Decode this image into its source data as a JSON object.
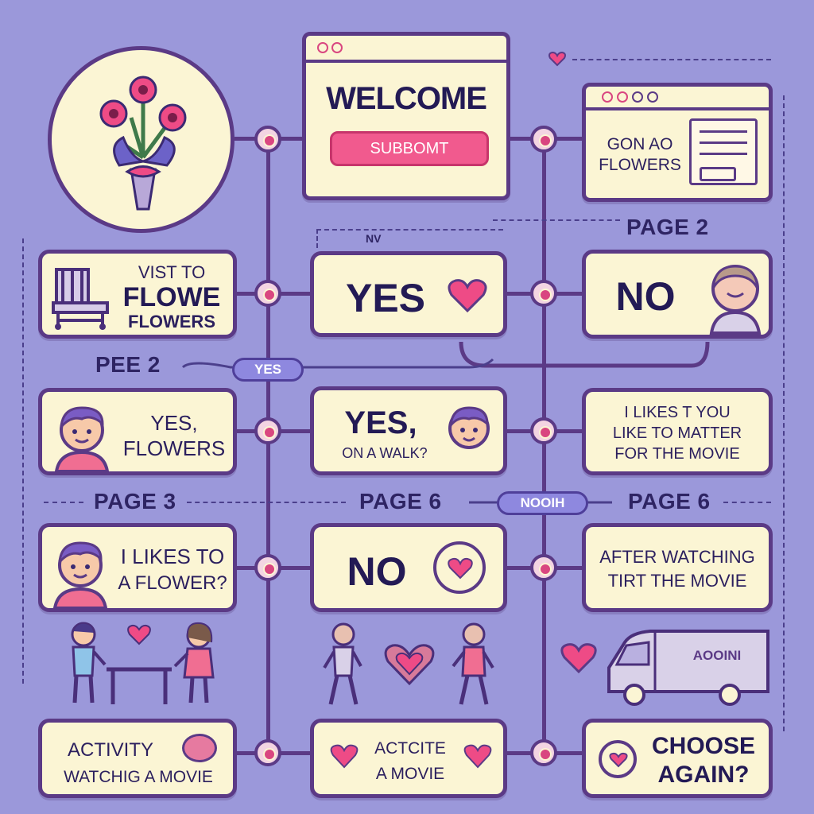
{
  "welcome_window": {
    "title": "WELCOME",
    "button_label": "SUBBOMT"
  },
  "flower_window": {
    "line1": "GON AO",
    "line2": "FLOWERS"
  },
  "labels": {
    "page2_top": "PAGE 2",
    "nav_caption": "NV",
    "pee2": "PEE 2",
    "yes_pill": "YES",
    "page3": "PAGE 3",
    "page6_mid": "PAGE 6",
    "nooh_pill": "NOOIH",
    "page6_right": "PAGE 6"
  },
  "rows": [
    {
      "left": {
        "line1": "VIST TO",
        "line2": "FLOWE",
        "line3": "FLOWERS"
      },
      "center": {
        "line1": "YES"
      },
      "right": {
        "line1": "NO"
      }
    },
    {
      "left": {
        "line1": "YES,",
        "line2": "FLOWERS"
      },
      "center": {
        "line1": "YES,",
        "line2": "ON A WALK?"
      },
      "right": {
        "line1": "I LIKES T YOU",
        "line2": "LIKE TO MATTER",
        "line3": "FOR THE MOVIE"
      }
    },
    {
      "left": {
        "line1": "I LIKES TO",
        "line2": "A FLOWER?"
      },
      "center": {
        "line1": "NO"
      },
      "right": {
        "line1": "AFTER WATCHING",
        "line2": "TIRT THE MOVIE"
      }
    },
    {
      "left": {
        "line1": "ACTIVITY",
        "line2": "WATCHIG A MOVIE"
      },
      "center": {
        "line1": "ACTCITE",
        "line2": "A MOVIE"
      },
      "right": {
        "line1": "CHOOSE",
        "line2": "AGAIN?"
      }
    }
  ],
  "van_label": "AOOINI",
  "colors": {
    "background": "#9b98da",
    "card": "#fbf5d4",
    "outline": "#5b3a86",
    "accent_pink": "#ee4b86",
    "text": "#2b1f5e"
  }
}
